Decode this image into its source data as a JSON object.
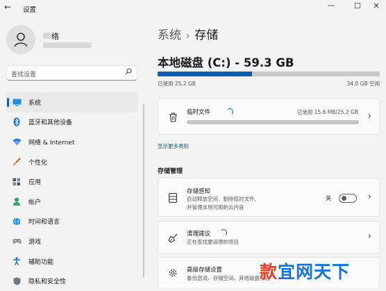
{
  "window": {
    "title": "设置",
    "back_glyph": "←",
    "minimize_glyph": "—",
    "maximize_glyph": "☐",
    "close_glyph": "✕"
  },
  "user": {
    "name_visible": "络"
  },
  "search": {
    "placeholder": "查找设置"
  },
  "sidebar": {
    "items": [
      {
        "label": "系统",
        "icon": "monitor-icon",
        "active": true
      },
      {
        "label": "蓝牙和其他设备",
        "icon": "bluetooth-icon"
      },
      {
        "label": "网络 & Internet",
        "icon": "wifi-icon"
      },
      {
        "label": "个性化",
        "icon": "brush-icon"
      },
      {
        "label": "应用",
        "icon": "apps-icon"
      },
      {
        "label": "帐户",
        "icon": "person-icon"
      },
      {
        "label": "时间和语言",
        "icon": "globe-clock-icon"
      },
      {
        "label": "游戏",
        "icon": "gamepad-icon"
      },
      {
        "label": "辅助功能",
        "icon": "accessibility-icon"
      },
      {
        "label": "隐私和安全性",
        "icon": "shield-icon"
      }
    ]
  },
  "breadcrumb": {
    "parent": "系统",
    "separator": "›",
    "current": "存储"
  },
  "disk": {
    "title": "本地磁盘 (C:) - 59.3 GB",
    "used_label": "已使用 25.2 GB",
    "free_label": "34.0 GB 空闲",
    "used_fraction": 0.425,
    "accent_color": "#005fb8"
  },
  "temp_files": {
    "title": "临时文件",
    "usage": "已使用 15.6 MB/25.2 GB"
  },
  "more_link": "显示更多类别",
  "management": {
    "heading": "存储管理",
    "items": [
      {
        "title": "存储感知",
        "desc_line1": "自动释放空间、删除临时文件,",
        "desc_line2": "并管理本地可用的云内容",
        "toggle_label": "关",
        "toggle_on": false,
        "icon": "storage-sense-icon"
      },
      {
        "title": "清理建议",
        "desc_line1": "正在查找要清理的项目",
        "icon": "broom-icon"
      },
      {
        "title": "高级存储设置",
        "desc_line1": "备份选项、存储空间、其他磁盘和卷",
        "icon": "gear-icon"
      }
    ]
  },
  "watermark": {
    "text_a": "款",
    "text_b": "宜网天下"
  }
}
